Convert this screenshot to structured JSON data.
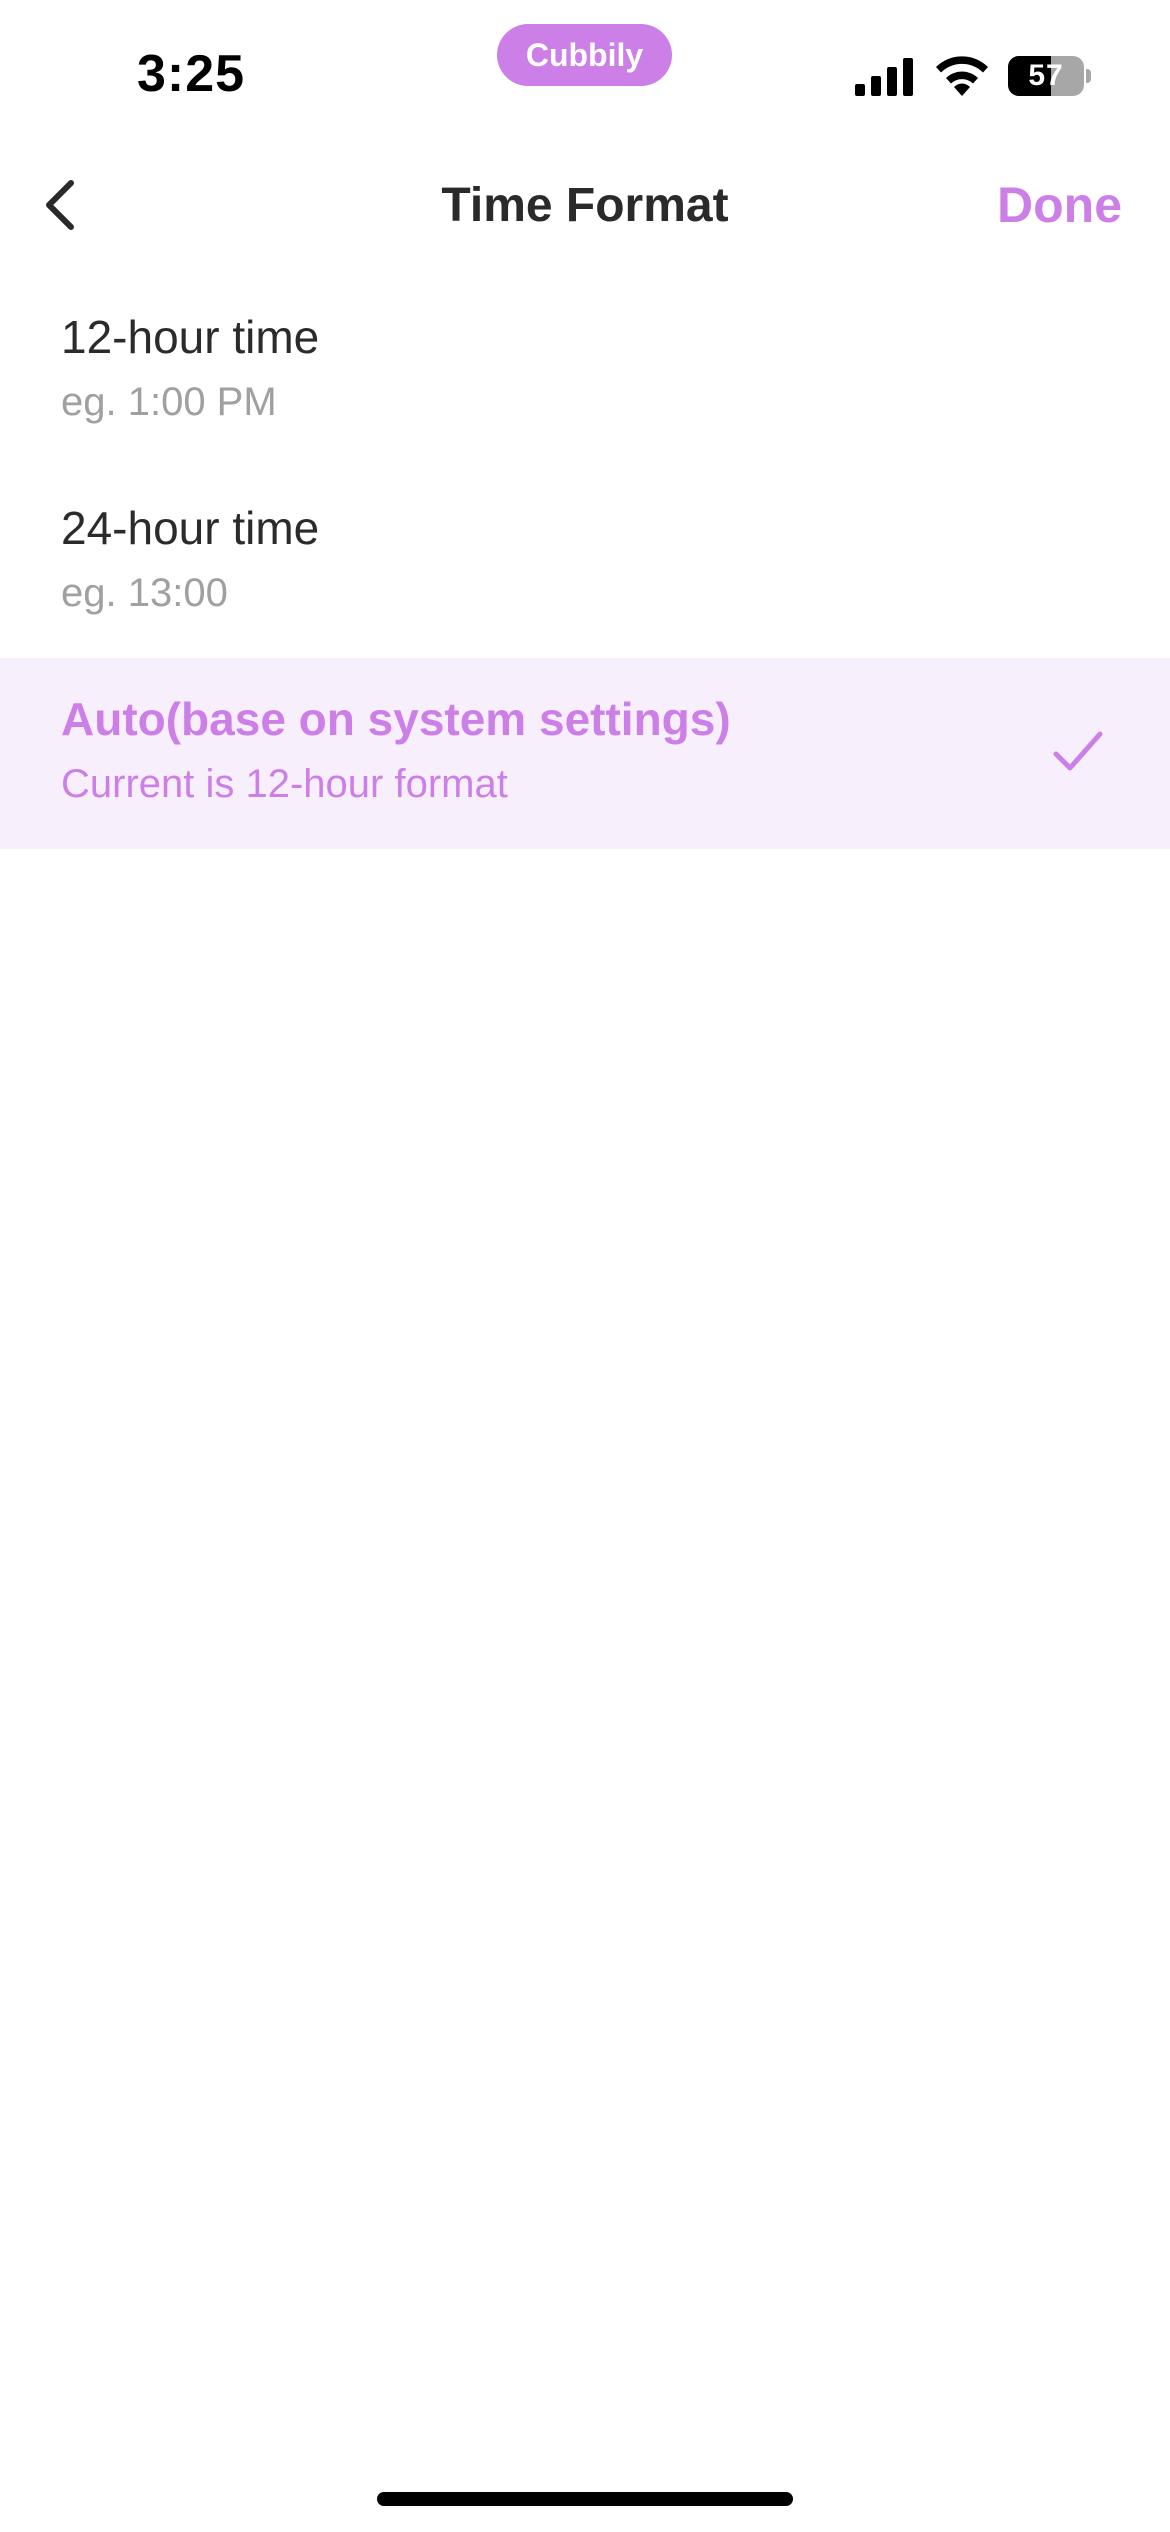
{
  "status_bar": {
    "time": "3:25",
    "app_pill": "Cubbily",
    "battery_level": "57",
    "battery_fraction": 0.57,
    "icons": [
      "signal-icon",
      "wifi-icon",
      "battery-icon"
    ]
  },
  "nav": {
    "back_icon": "chevron-left-icon",
    "title": "Time Format",
    "done_label": "Done"
  },
  "options": [
    {
      "label": "12-hour time",
      "sub": "eg. 1:00 PM",
      "selected": false
    },
    {
      "label": "24-hour time",
      "sub": "eg. 13:00",
      "selected": false
    },
    {
      "label": "Auto(base on system settings)",
      "sub": "Current is 12-hour format",
      "selected": true
    }
  ],
  "colors": {
    "accent": "#cd7fe8",
    "selected_bg": "#f8effd",
    "primary_text": "#2b2b2b",
    "secondary_text": "#a0a0a0"
  }
}
